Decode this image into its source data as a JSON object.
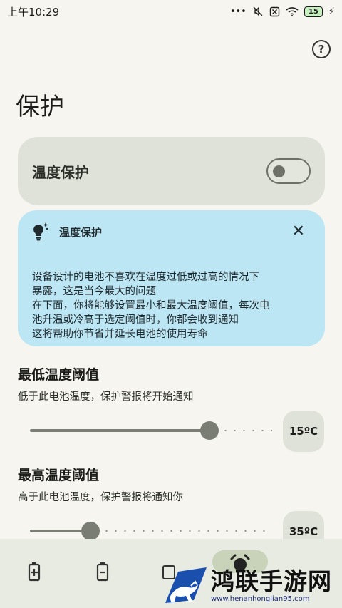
{
  "status_bar": {
    "time": "上午10:29",
    "battery": "15"
  },
  "header": {
    "help_icon": "help-circle-icon"
  },
  "page": {
    "title": "保护"
  },
  "temperature_protection": {
    "label": "温度保护",
    "enabled": false
  },
  "info_card": {
    "icon": "lightbulb-sparkle-icon",
    "title": "温度保护",
    "lines": [
      "设备设计的电池不喜欢在温度过低或过高的情况下",
      "暴露，这是当今最大的问题",
      "在下面，你将能够设置最小和最大温度阈值，每次电",
      "池升温或冷高于选定阈值时，你都会收到通知",
      "这将帮助你节省并延长电池的使用寿命"
    ]
  },
  "min_threshold": {
    "title": "最低温度阈值",
    "description": "低于此电池温度，保护警报将开始通知",
    "value_label": "15ºC",
    "fraction": 0.74
  },
  "max_threshold": {
    "title": "最高温度阈值",
    "description": "高于此电池温度，保护警报将通知你",
    "value_label": "35ºC",
    "fraction": 0.25
  },
  "bottom_nav": {
    "items": [
      {
        "icon": "battery-charging-icon"
      },
      {
        "icon": "battery-icon"
      },
      {
        "icon": "stats-icon"
      },
      {
        "icon": "alarm-icon",
        "active": true
      }
    ]
  },
  "watermark": {
    "text": "鸿联手游网",
    "url": "www.henanhonglian95.com"
  },
  "colors": {
    "background": "#f7f5ef",
    "card": "#dfe2d8",
    "info_card": "#bde6f5",
    "slider": "#7a7d74"
  }
}
